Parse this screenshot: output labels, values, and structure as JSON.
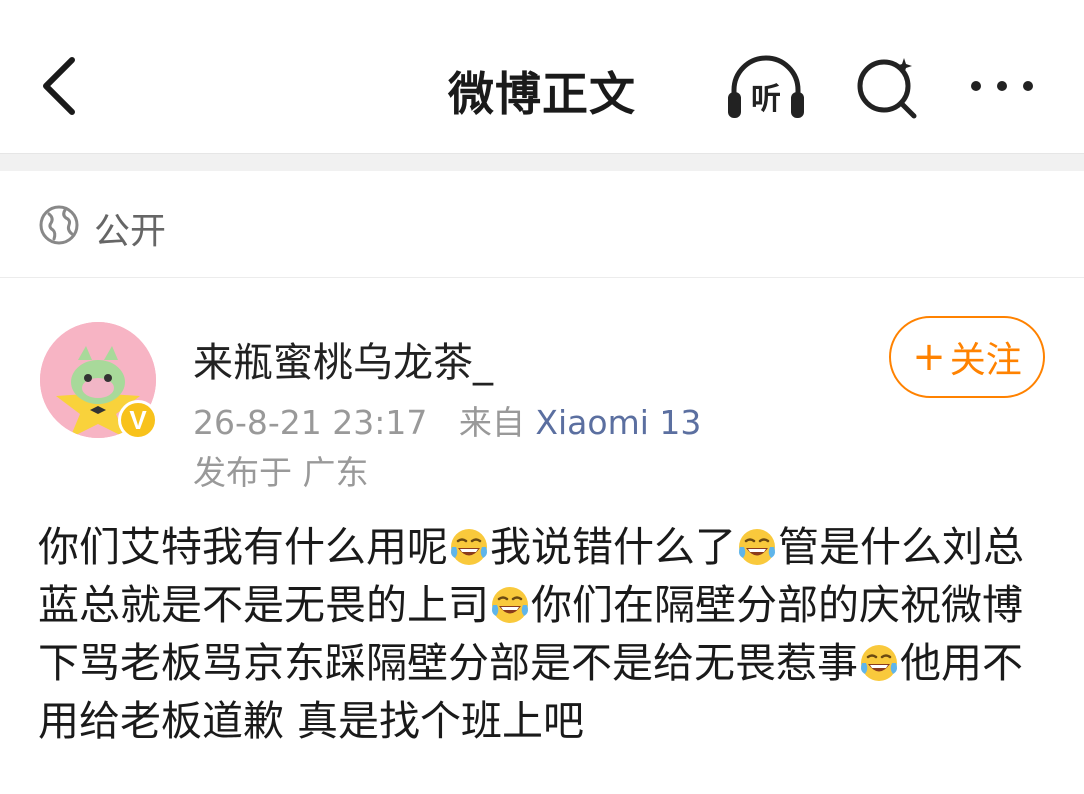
{
  "header": {
    "title": "微博正文",
    "listen_label": "听",
    "icons": [
      "back-arrow-icon",
      "headphones-icon",
      "search-icon",
      "more-icon"
    ]
  },
  "visibility": {
    "icon": "globe-icon",
    "label": "公开"
  },
  "author": {
    "name": "来瓶蜜桃乌龙茶_",
    "verified_badge": "V",
    "time": "26-8-21 23:17",
    "from_label": "来自",
    "source": "Xiaomi 13",
    "location": "发布于 广东"
  },
  "follow": {
    "plus": "+",
    "label": "关注"
  },
  "post": {
    "segments": [
      "你们艾特我有什么用呢",
      "我说错什么了",
      "管是什么刘总蓝总就是不是无畏的上司",
      "你们在隔壁分部的庆祝微博下骂老板骂京东踩隔壁分部是不是给无畏惹事",
      "他用不用给老板道歉 真是找个班上吧"
    ],
    "emoji": "laughing-tears-emoji"
  },
  "colors": {
    "accent": "#ff8200",
    "source_link": "#5b6fa0",
    "meta_gray": "#999999",
    "badge_yellow": "#f8c21b",
    "divider_gray": "#f1f1f1"
  }
}
